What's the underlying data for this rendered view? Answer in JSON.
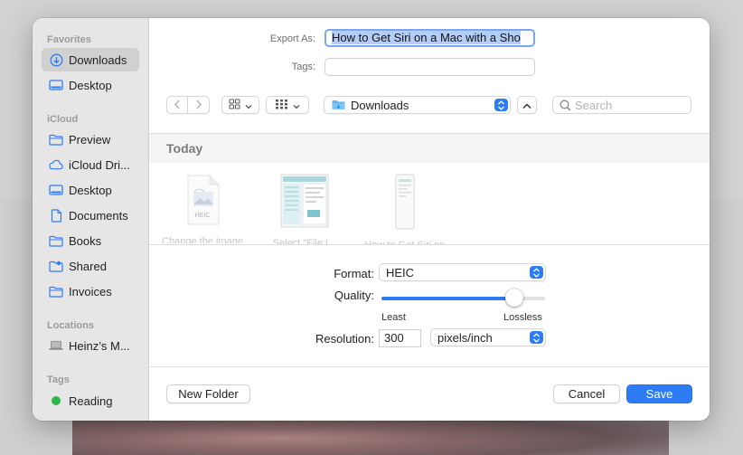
{
  "sidebar": {
    "sections": [
      {
        "title": "Favorites",
        "items": [
          {
            "label": "Downloads",
            "icon": "downloads-icon",
            "active": true
          },
          {
            "label": "Desktop",
            "icon": "desktop-icon"
          }
        ]
      },
      {
        "title": "iCloud",
        "items": [
          {
            "label": "Preview",
            "icon": "folder-icon"
          },
          {
            "label": "iCloud Dri...",
            "icon": "cloud-icon"
          },
          {
            "label": "Desktop",
            "icon": "desktop-icon"
          },
          {
            "label": "Documents",
            "icon": "document-icon"
          },
          {
            "label": "Books",
            "icon": "folder-icon"
          },
          {
            "label": "Shared",
            "icon": "shared-folder-icon"
          },
          {
            "label": "Invoices",
            "icon": "folder-icon"
          }
        ]
      },
      {
        "title": "Locations",
        "items": [
          {
            "label": "Heinz’s M...",
            "icon": "laptop-icon"
          }
        ]
      },
      {
        "title": "Tags",
        "items": [
          {
            "label": "Reading",
            "icon": "green-tag-dot-icon",
            "color": "#2fb84a"
          }
        ]
      }
    ]
  },
  "export": {
    "label": "Export As:",
    "value": "How to Get Siri on a Mac with a Sho",
    "tags_label": "Tags:"
  },
  "toolbar": {
    "location": "Downloads",
    "search_placeholder": "Search"
  },
  "browser": {
    "group": "Today",
    "files": [
      {
        "name": "Change the image",
        "badge": "HEIC"
      },
      {
        "name": "Select \"File I...",
        "badge": ""
      },
      {
        "name": "How to Get Siri on",
        "badge": ""
      }
    ]
  },
  "options": {
    "format_label": "Format:",
    "format_value": "HEIC",
    "quality_label": "Quality:",
    "quality_level": 0.81,
    "quality_min_label": "Least",
    "quality_max_label": "Lossless",
    "resolution_label": "Resolution:",
    "resolution_value": "300",
    "resolution_unit": "pixels/inch"
  },
  "footer": {
    "new_folder": "New Folder",
    "cancel": "Cancel",
    "save": "Save"
  },
  "colors": {
    "accent": "#2e7bf6",
    "tag_green": "#2fb84a"
  }
}
